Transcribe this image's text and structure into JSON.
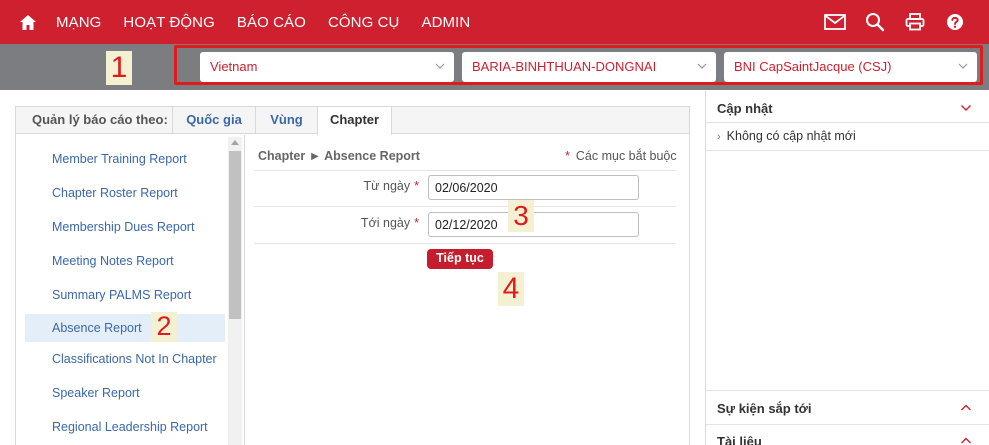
{
  "nav": {
    "items": [
      "MẠNG",
      "HOẠT ĐỘNG",
      "BÁO CÁO",
      "CÔNG CỤ",
      "ADMIN"
    ],
    "icons": [
      "home-icon",
      "mail-icon",
      "search-icon",
      "printer-icon",
      "help-icon"
    ]
  },
  "filters": {
    "country": "Vietnam",
    "region": "BARIA-BINHTHUAN-DONGNAI",
    "chapter": "BNI CapSaintJacque (CSJ)"
  },
  "annotations": [
    "1",
    "2",
    "3",
    "4"
  ],
  "tabs": {
    "label": "Quản lý báo cáo theo:",
    "country": "Quốc gia",
    "region": "Vùng",
    "chapter": "Chapter"
  },
  "reports": [
    "Member Training Report",
    "Chapter Roster Report",
    "Membership Dues Report",
    "Meeting Notes Report",
    "Summary PALMS Report",
    "Absence Report",
    "Classifications Not In Chapter",
    "Speaker Report",
    "Regional Leadership Report"
  ],
  "form": {
    "breadcrumb": "Chapter ► Absence Report",
    "required_star": "*",
    "required_note": "Các mục bắt buộc",
    "from_label": "Từ ngày",
    "from_value": "02/06/2020",
    "to_label": "Tới ngày",
    "to_value": "02/12/2020",
    "submit_label": "Tiếp tục"
  },
  "sidebar": {
    "updates_title": "Cập nhật",
    "updates_item": "Không có cập nhật mới",
    "events_title": "Sự kiện sắp tới",
    "docs_title": "Tài liệu"
  },
  "colors": {
    "brand_red": "#cf2030",
    "bar_gray": "#7b7d80",
    "link_blue": "#3a68a8",
    "annotation_red": "#e11a1a"
  }
}
